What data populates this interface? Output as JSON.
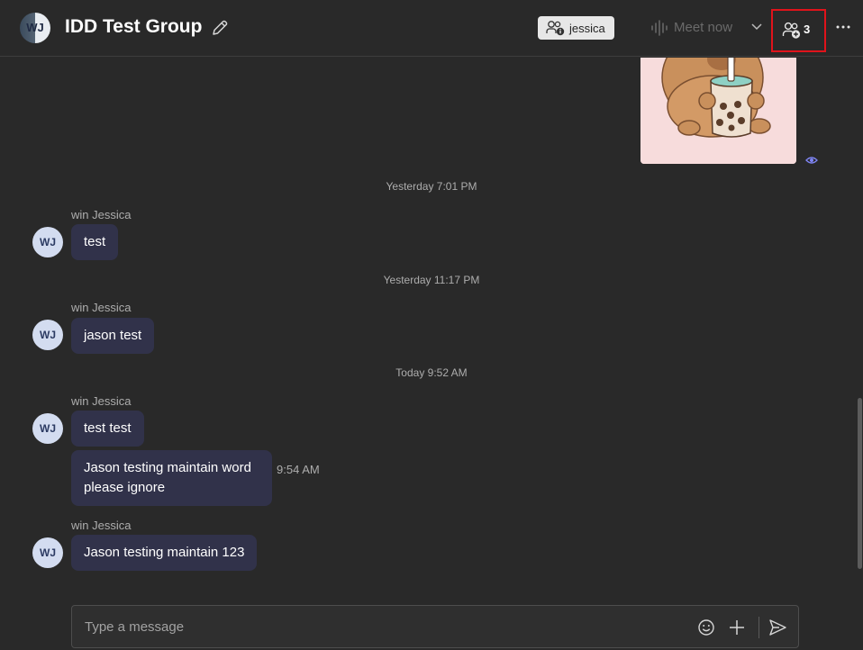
{
  "header": {
    "avatar_initials": "WJ",
    "title": "IDD Test Group",
    "user_chip": "jessica",
    "meet_now": "Meet now",
    "participants_count": "3"
  },
  "messages": [
    {
      "divider": "Yesterday 7:01 PM",
      "sender": "win Jessica",
      "initials": "WJ",
      "text": "test"
    },
    {
      "divider": "Yesterday 11:17 PM",
      "sender": "win Jessica",
      "initials": "WJ",
      "text": "jason test"
    },
    {
      "divider": "Today 9:52 AM",
      "sender": "win Jessica",
      "initials": "WJ",
      "text": "test test",
      "followup_line1": "Jason testing maintain word",
      "followup_line2": "please ignore",
      "followup_time": "9:54 AM"
    },
    {
      "sender": "win Jessica",
      "initials": "WJ",
      "text": "Jason testing maintain 123"
    }
  ],
  "compose": {
    "placeholder": "Type a message"
  },
  "colors": {
    "accent": "#e0131b",
    "bubble": "#31324a",
    "background": "#292929"
  }
}
